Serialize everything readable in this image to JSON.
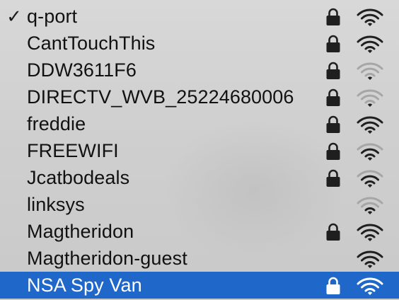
{
  "networks": [
    {
      "ssid": "q-port",
      "checked": true,
      "locked": true,
      "signal": 4
    },
    {
      "ssid": "CantTouchThis",
      "checked": false,
      "locked": true,
      "signal": 4
    },
    {
      "ssid": "DDW3611F6",
      "checked": false,
      "locked": true,
      "signal": 1
    },
    {
      "ssid": "DIRECTV_WVB_25224680006",
      "checked": false,
      "locked": true,
      "signal": 1
    },
    {
      "ssid": "freddie",
      "checked": false,
      "locked": true,
      "signal": 4
    },
    {
      "ssid": "FREEWIFI",
      "checked": false,
      "locked": true,
      "signal": 3
    },
    {
      "ssid": "Jcatbodeals",
      "checked": false,
      "locked": true,
      "signal": 3
    },
    {
      "ssid": "linksys",
      "checked": false,
      "locked": false,
      "signal": 2
    },
    {
      "ssid": "Magtheridon",
      "checked": false,
      "locked": true,
      "signal": 4
    },
    {
      "ssid": "Magtheridon-guest",
      "checked": false,
      "locked": false,
      "signal": 4
    },
    {
      "ssid": "NSA Spy Van",
      "checked": false,
      "locked": true,
      "signal": 4,
      "selected": true
    }
  ],
  "checkmark": "✓",
  "colors": {
    "background": "#cfcfcf",
    "text": "#111111",
    "selected_bg": "#1f67c9",
    "selected_text": "#ffffff",
    "icon_dark": "#1f1f1f",
    "icon_light": "#a6a6a6"
  }
}
